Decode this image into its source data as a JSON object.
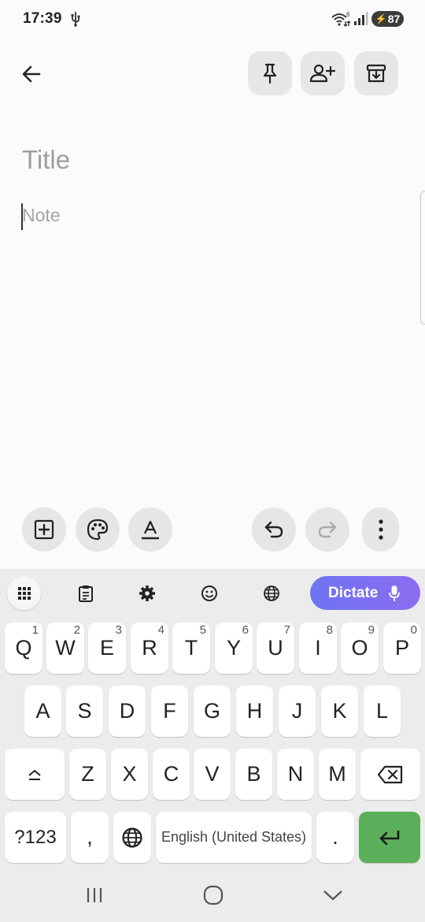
{
  "status_bar": {
    "time": "17:39",
    "wifi_badge": "6",
    "battery": "87",
    "icons": [
      "usb-icon",
      "wifi-icon",
      "signal-icon",
      "battery-charging-icon"
    ]
  },
  "top_bar": {
    "icons": [
      "back-arrow-icon",
      "pin-icon",
      "add-collaborator-icon",
      "archive-icon"
    ]
  },
  "editor": {
    "title_placeholder": "Title",
    "note_placeholder": "Note"
  },
  "bottom_toolbar": {
    "icons": [
      "add-box-icon",
      "palette-icon",
      "text-format-icon",
      "undo-icon",
      "redo-icon",
      "more-vert-icon"
    ]
  },
  "keyboard": {
    "toolbar_icons": [
      "keyboard-apps-icon",
      "clipboard-icon",
      "settings-icon",
      "emoji-icon",
      "globe-icon"
    ],
    "dictate_label": "Dictate",
    "row1": [
      {
        "label": "Q",
        "hint": "1"
      },
      {
        "label": "W",
        "hint": "2"
      },
      {
        "label": "E",
        "hint": "3"
      },
      {
        "label": "R",
        "hint": "4"
      },
      {
        "label": "T",
        "hint": "5"
      },
      {
        "label": "Y",
        "hint": "6"
      },
      {
        "label": "U",
        "hint": "7"
      },
      {
        "label": "I",
        "hint": "8"
      },
      {
        "label": "O",
        "hint": "9"
      },
      {
        "label": "P",
        "hint": "0"
      }
    ],
    "row2": [
      "A",
      "S",
      "D",
      "F",
      "G",
      "H",
      "J",
      "K",
      "L"
    ],
    "row3": [
      "Z",
      "X",
      "C",
      "V",
      "B",
      "N",
      "M"
    ],
    "symbols_label": "?123",
    "comma_label": ",",
    "space_label": "English (United States)",
    "period_label": "."
  },
  "nav_bar": {
    "icons": [
      "recents-icon",
      "home-icon",
      "back-chevron-icon"
    ]
  },
  "colors": {
    "background": "#fbfbfe",
    "dictate_gradient_start": "#6e74f2",
    "dictate_gradient_end": "#8c6cf0",
    "enter_key": "#5caf5a"
  }
}
